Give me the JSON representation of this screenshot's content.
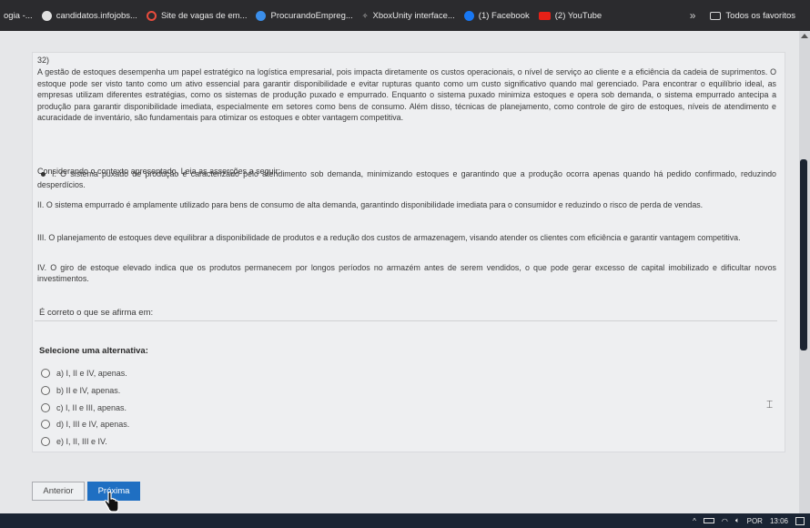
{
  "bookmarks": {
    "items": [
      {
        "label": "ogia -...",
        "icon": "page-icon",
        "color": "#2b2b2e"
      },
      {
        "label": "candidatos.infojobs...",
        "icon": "infojobs-icon",
        "color": "#e0e0e0"
      },
      {
        "label": "Site de vagas de em...",
        "icon": "ring-icon",
        "color": "#e84c3d"
      },
      {
        "label": "ProcurandoEmpreg...",
        "icon": "search-icon",
        "color": "#3b8eea"
      },
      {
        "label": "XboxUnity interface...",
        "icon": "xbox-icon",
        "color": "#cfcfcf"
      },
      {
        "label": "(1) Facebook",
        "icon": "facebook-icon",
        "color": "#1877f2"
      },
      {
        "label": "(2) YouTube",
        "icon": "youtube-icon",
        "color": "#e62117"
      }
    ],
    "more": "»",
    "all_favorites": "Todos os favoritos"
  },
  "question": {
    "number": "32)",
    "intro": "A gestão de estoques desempenha um papel estratégico na logística empresarial, pois impacta diretamente os custos operacionais, o nível de serviço ao cliente e a eficiência da cadeia de suprimentos. O estoque pode ser visto tanto como um ativo essencial para garantir disponibilidade e evitar rupturas quanto como um custo significativo quando mal gerenciado. Para encontrar o equilíbrio ideal, as empresas utilizam diferentes estratégias, como os sistemas de produção puxado e empurrado. Enquanto o sistema puxado minimiza estoques e opera sob demanda, o sistema empurrado antecipa a produção para garantir disponibilidade imediata, especialmente em setores como bens de consumo. Além disso, técnicas de planejamento, como controle de giro de estoques, níveis de atendimento e acuracidade de inventário, são fundamentais para otimizar os estoques e obter vantagem competitiva.",
    "context": "Considerando o contexto apresentado, Leia as asserções a seguir:",
    "assertions": [
      "I. O sistema puxado de produção é caracterizado pelo atendimento sob demanda, minimizando estoques e garantindo que a produção ocorra apenas quando há pedido confirmado, reduzindo desperdícios.",
      "II. O sistema empurrado é amplamente utilizado para bens de consumo de alta demanda, garantindo disponibilidade imediata para o consumidor e reduzindo o risco de perda de vendas.",
      "III. O planejamento de estoques deve equilibrar a disponibilidade de produtos e a redução dos custos de armazenagem, visando atender os clientes com eficiência e garantir vantagem competitiva.",
      "IV. O giro de estoque elevado indica que os produtos permanecem por longos períodos no armazém antes de serem vendidos, o que pode gerar excesso de capital imobilizado e dificultar novos investimentos."
    ],
    "prompt": "É correto o que se afirma em:"
  },
  "answers": {
    "label": "Selecione uma alternativa:",
    "options": [
      "a) I, II e IV, apenas.",
      "b) II e IV, apenas.",
      "c) I, II e III, apenas.",
      "d) I, III e IV, apenas.",
      "e) I, II, III e IV."
    ]
  },
  "nav": {
    "prev_label": "Anterior",
    "next_label": "Próxima"
  },
  "taskbar": {
    "language": "POR",
    "time": "13:06",
    "chevron": "^",
    "wifi_icon": "wifi-icon",
    "volume_icon": "volume-icon",
    "battery_icon": "battery-icon"
  },
  "colors": {
    "primary_button": "#1f6fc2",
    "page_bg": "#e6e7e9",
    "card_bg": "#eeeff1"
  }
}
